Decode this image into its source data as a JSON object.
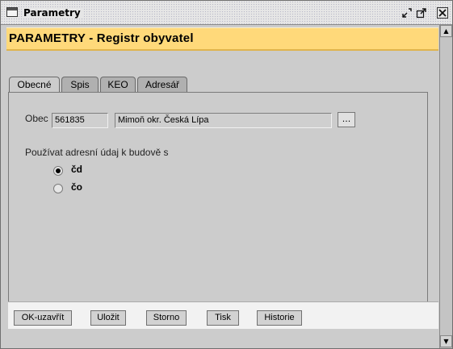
{
  "window": {
    "title": "Parametry"
  },
  "header": {
    "title": "PARAMETRY - Registr obyvatel"
  },
  "tabs": [
    {
      "label": "Obecné",
      "active": true
    },
    {
      "label": "Spis",
      "active": false
    },
    {
      "label": "KEO",
      "active": false
    },
    {
      "label": "Adresář",
      "active": false
    }
  ],
  "obec": {
    "label": "Obec",
    "code": "561835",
    "name": "Mimoň okr. Česká Lípa",
    "lookup_label": "..."
  },
  "address": {
    "question": "Používat adresní údaj k budově s",
    "options": [
      {
        "label": "čd",
        "selected": true
      },
      {
        "label": "čo",
        "selected": false
      }
    ]
  },
  "buttons": {
    "ok": "OK-uzavřít",
    "save": "Uložit",
    "cancel": "Storno",
    "print": "Tisk",
    "history": "Historie"
  },
  "colors": {
    "header_bg": "#ffd97a",
    "panel_bg": "#cccccc",
    "button_bar_bg": "#f2f2f2"
  }
}
